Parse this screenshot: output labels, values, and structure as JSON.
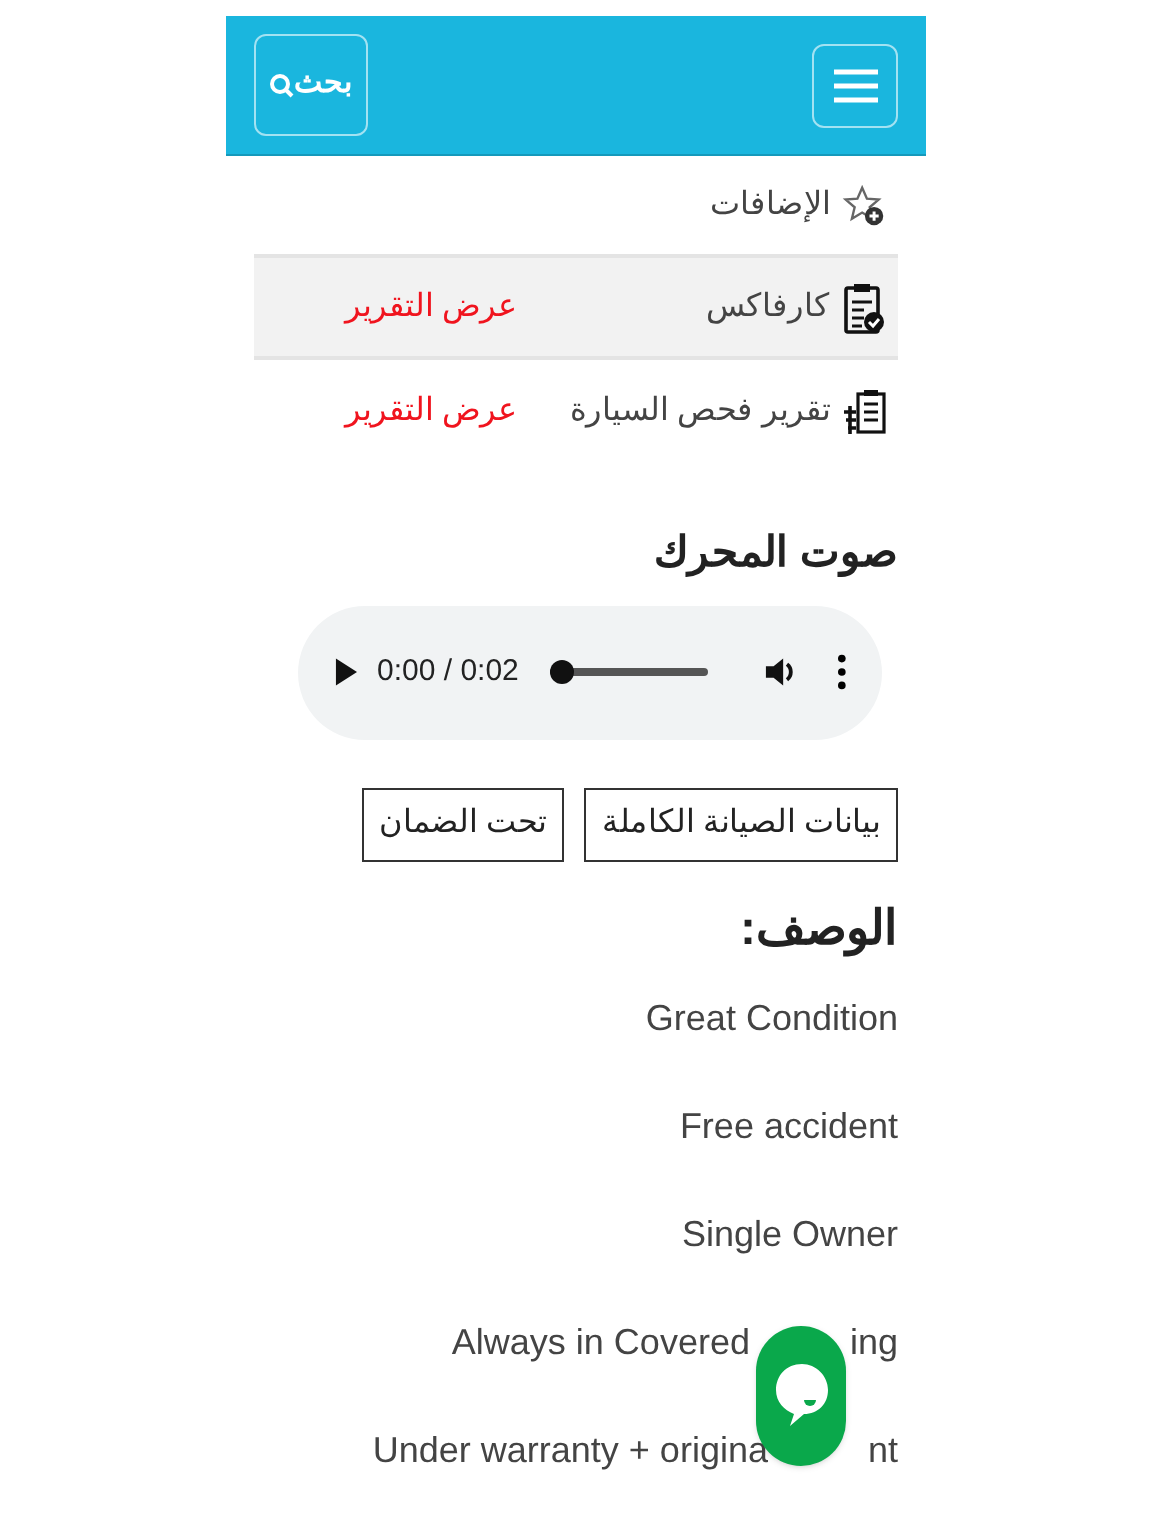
{
  "header": {
    "search_label": "بحث"
  },
  "reports": [
    {
      "kind": "plain",
      "title": "الإضافات",
      "highlighted": false
    },
    {
      "kind": "carfax",
      "title": "كارفاكس",
      "link": "عرض التقرير",
      "highlighted": true
    },
    {
      "kind": "inspection",
      "title": "تقرير فحص السيارة",
      "link": "عرض التقرير",
      "highlighted": false
    }
  ],
  "engine_sound": {
    "title": "صوت المحرك",
    "time": "0:00 / 0:02",
    "level": 0
  },
  "buttons": [
    "بيانات الصيانة الكاملة",
    "تحت الضمان"
  ],
  "description": {
    "title": "الوصف:",
    "lines": [
      {
        "text": "Great Condition"
      },
      {
        "text": "Free accident"
      },
      {
        "text": "Single Owner"
      },
      {
        "text": "Always in Covered",
        "tail": "ing"
      },
      {
        "text": "Under warranty + origina",
        "tail": "nt"
      }
    ]
  }
}
